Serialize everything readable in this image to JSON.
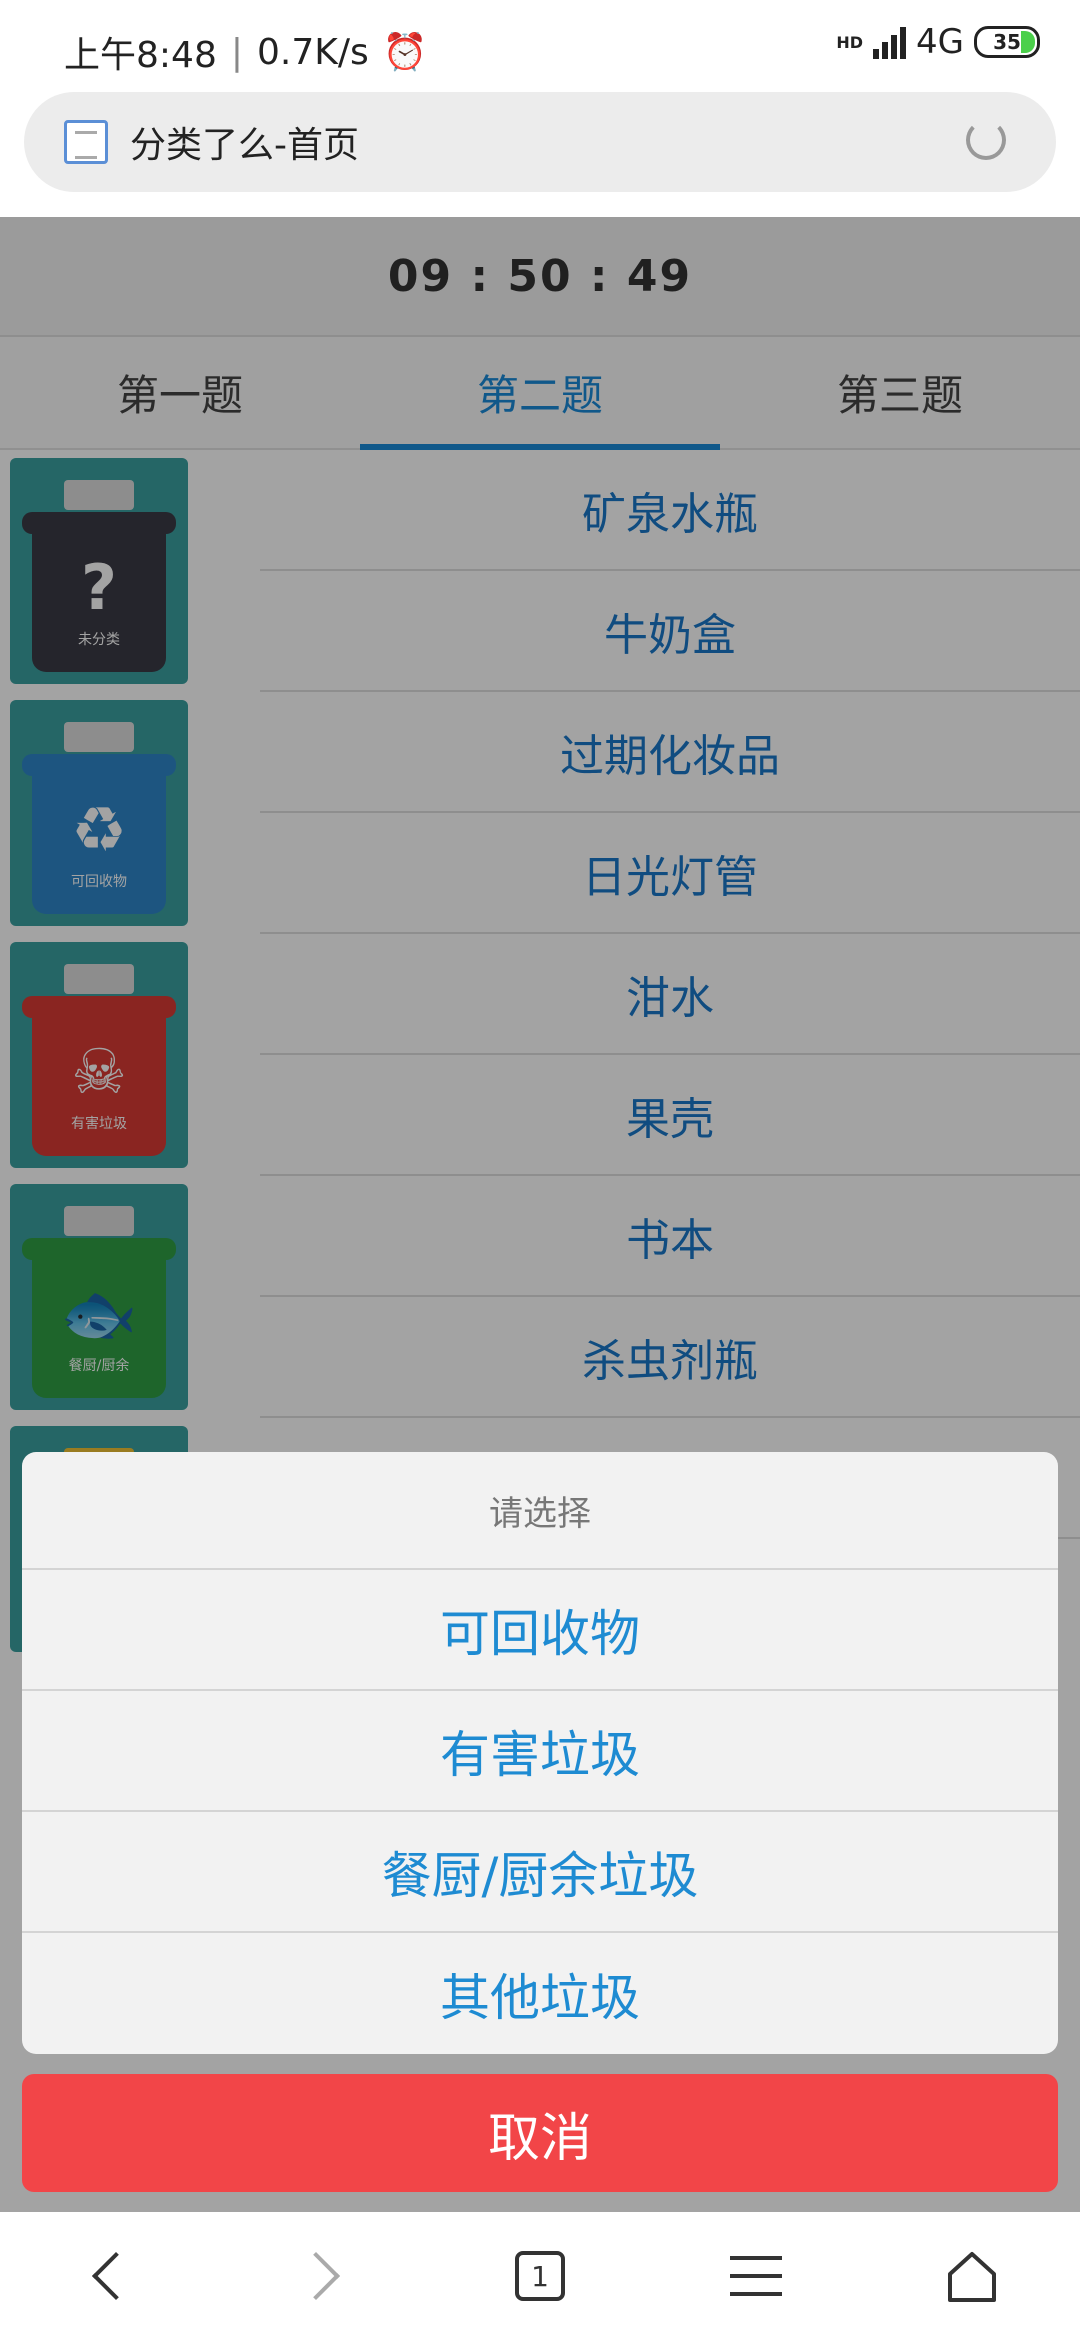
{
  "status_bar": {
    "time": "上午8:48",
    "separator": "|",
    "speed": "0.7K/s",
    "alarm_icon": "⏰",
    "hd_label": "HD",
    "network": "4G",
    "battery": "35"
  },
  "browser": {
    "page_title": "分类了么-首页"
  },
  "timer": "09 : 50 : 49",
  "tabs": [
    {
      "label": "第一题"
    },
    {
      "label": "第二题"
    },
    {
      "label": "第三题"
    }
  ],
  "bins": [
    {
      "caption": "未分类",
      "glyph": "?",
      "color": "#3b3b46",
      "icon": "question-mark-icon"
    },
    {
      "caption": "可回收物",
      "glyph": "♻",
      "color": "#2e86c9",
      "icon": "recycle-icon"
    },
    {
      "caption": "有害垃圾",
      "glyph": "☠",
      "color": "#d83a34",
      "icon": "skull-icon"
    },
    {
      "caption": "餐厨/厨余",
      "glyph": "🐟",
      "color": "#2f9e44",
      "icon": "fish-bone-icon"
    }
  ],
  "items": [
    "矿泉水瓶",
    "牛奶盒",
    "过期化妆品",
    "日光灯管",
    "泔水",
    "果壳",
    "书本",
    "杀虫剂瓶"
  ],
  "action_sheet": {
    "title": "请选择",
    "options": [
      "可回收物",
      "有害垃圾",
      "餐厨/厨余垃圾",
      "其他垃圾"
    ],
    "cancel": "取消"
  },
  "bottom_nav": {
    "tab_count": "1"
  }
}
